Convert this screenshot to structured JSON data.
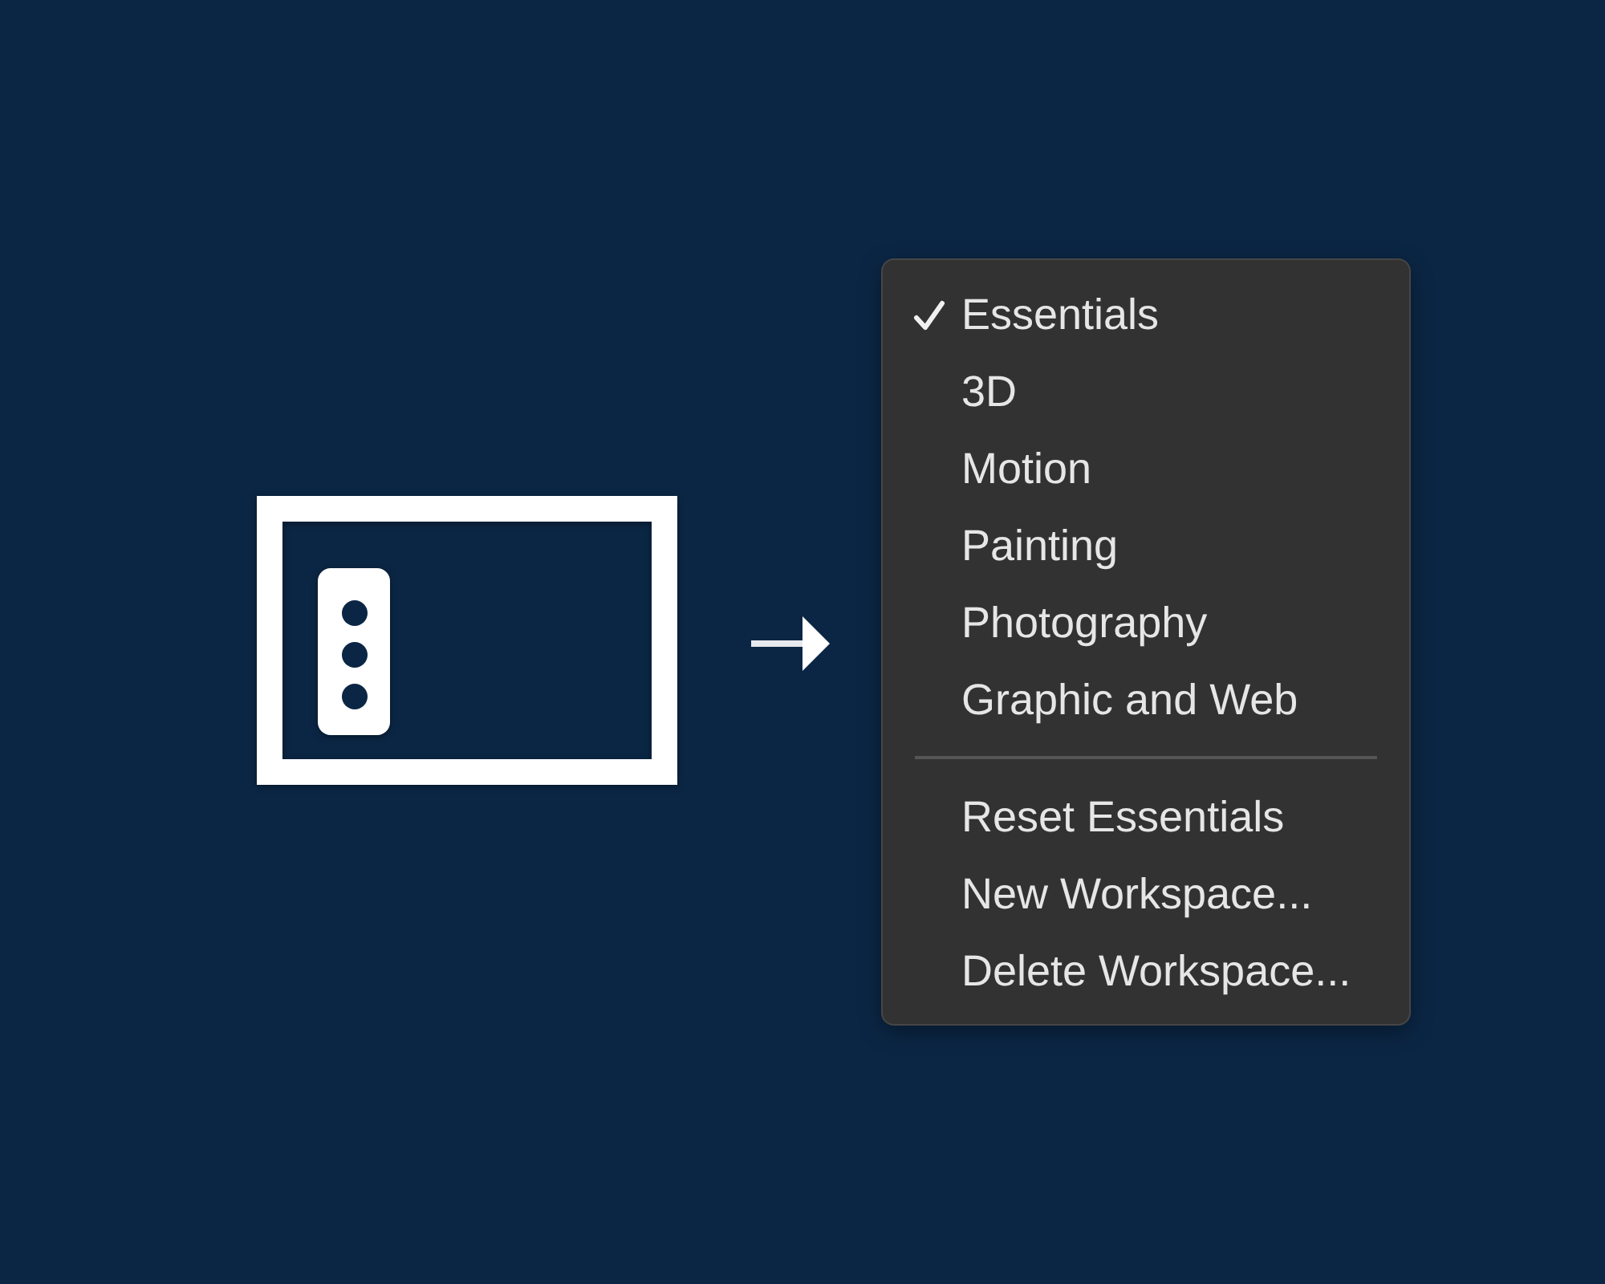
{
  "menu": {
    "workspaces": [
      {
        "label": "Essentials",
        "selected": true
      },
      {
        "label": "3D",
        "selected": false
      },
      {
        "label": "Motion",
        "selected": false
      },
      {
        "label": "Painting",
        "selected": false
      },
      {
        "label": "Photography",
        "selected": false
      },
      {
        "label": "Graphic and Web",
        "selected": false
      }
    ],
    "actions": [
      {
        "label": "Reset Essentials"
      },
      {
        "label": "New Workspace..."
      },
      {
        "label": "Delete Workspace..."
      }
    ]
  }
}
